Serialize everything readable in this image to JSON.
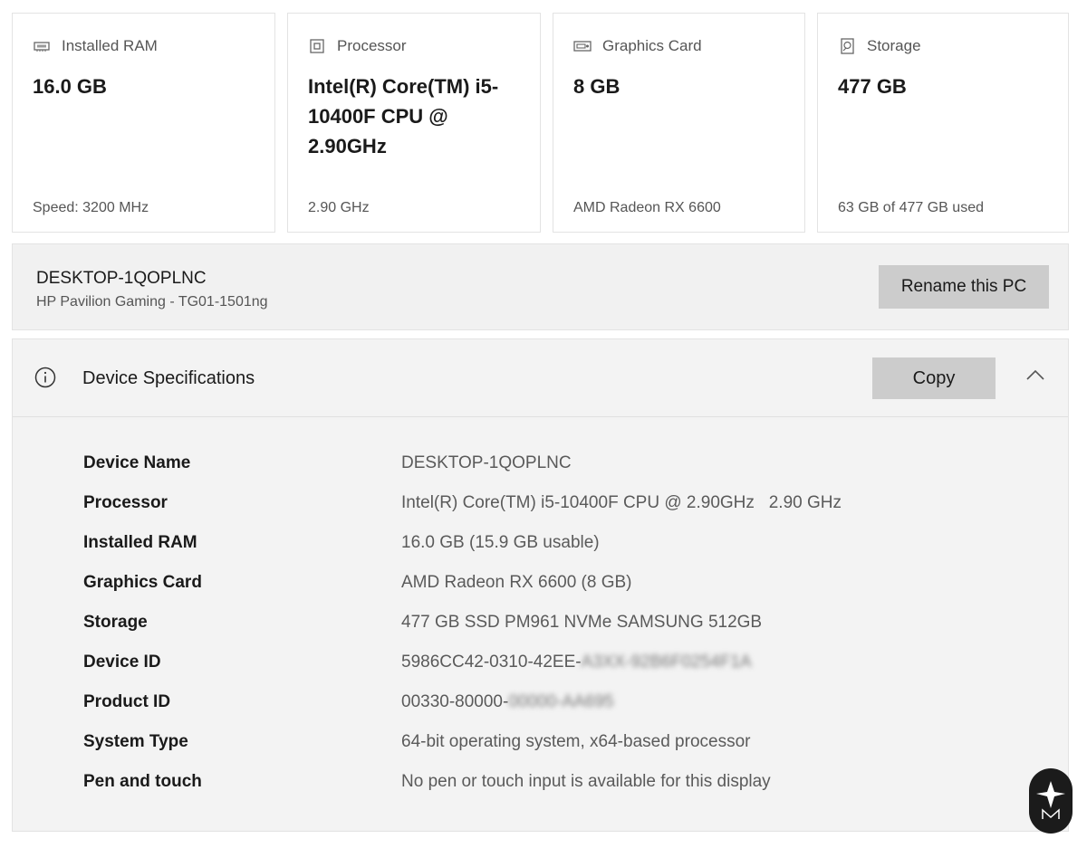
{
  "cards": [
    {
      "icon": "ram-icon",
      "label": "Installed RAM",
      "value": "16.0 GB",
      "footer": "Speed: 3200 MHz"
    },
    {
      "icon": "processor-icon",
      "label": "Processor",
      "value": "Intel(R) Core(TM) i5-10400F CPU @ 2.90GHz",
      "footer": "2.90 GHz"
    },
    {
      "icon": "graphics-card-icon",
      "label": "Graphics Card",
      "value": "8 GB",
      "footer": "AMD Radeon RX 6600"
    },
    {
      "icon": "storage-icon",
      "label": "Storage",
      "value": "477 GB",
      "footer": "63 GB of 477 GB used"
    }
  ],
  "pc": {
    "name": "DESKTOP-1QOPLNC",
    "model": "HP Pavilion Gaming - TG01-1501ng",
    "rename_label": "Rename this PC"
  },
  "specs": {
    "title": "Device Specifications",
    "copy_label": "Copy",
    "rows": [
      {
        "label": "Device Name",
        "value": "DESKTOP-1QOPLNC",
        "hidden": ""
      },
      {
        "label": "Processor",
        "value": "Intel(R) Core(TM) i5-10400F CPU @ 2.90GHz   2.90 GHz",
        "hidden": ""
      },
      {
        "label": "Installed RAM",
        "value": "16.0 GB (15.9 GB usable)",
        "hidden": ""
      },
      {
        "label": "Graphics Card",
        "value": "AMD Radeon RX 6600 (8 GB)",
        "hidden": ""
      },
      {
        "label": "Storage",
        "value": "477 GB SSD PM961 NVMe SAMSUNG 512GB",
        "hidden": ""
      },
      {
        "label": "Device ID",
        "value": "5986CC42-0310-42EE-",
        "hidden": "A3XX-92B6F0254F1A"
      },
      {
        "label": "Product ID",
        "value": "00330-80000-",
        "hidden": "00000-AA695"
      },
      {
        "label": "System Type",
        "value": "64-bit operating system, x64-based processor",
        "hidden": ""
      },
      {
        "label": "Pen and touch",
        "value": "No pen or touch input is available for this display",
        "hidden": ""
      }
    ]
  },
  "colors": {
    "button": "#cccccc",
    "panel": "#f3f3f3",
    "badge": "#1b1b1b"
  }
}
